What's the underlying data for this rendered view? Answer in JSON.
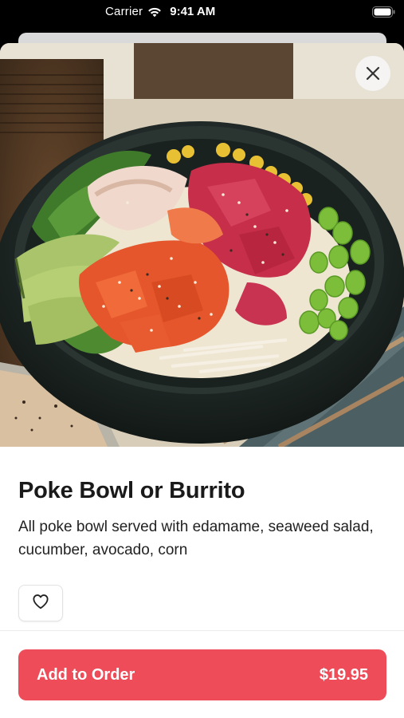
{
  "status_bar": {
    "carrier": "Carrier",
    "time": "9:41 AM",
    "wifi_icon": "wifi-icon",
    "battery_icon": "battery-icon"
  },
  "item": {
    "image_alt": "poke-bowl-photo",
    "title": "Poke Bowl or Burrito",
    "description": "All poke bowl served with edamame, seaweed salad, cucumber, avocado, corn"
  },
  "actions": {
    "close_icon": "close-icon",
    "favorite_icon": "heart-icon",
    "add_to_order_label": "Add to Order",
    "price": "$19.95"
  },
  "colors": {
    "accent": "#ee4c58",
    "text_primary": "#1a1a1a"
  }
}
